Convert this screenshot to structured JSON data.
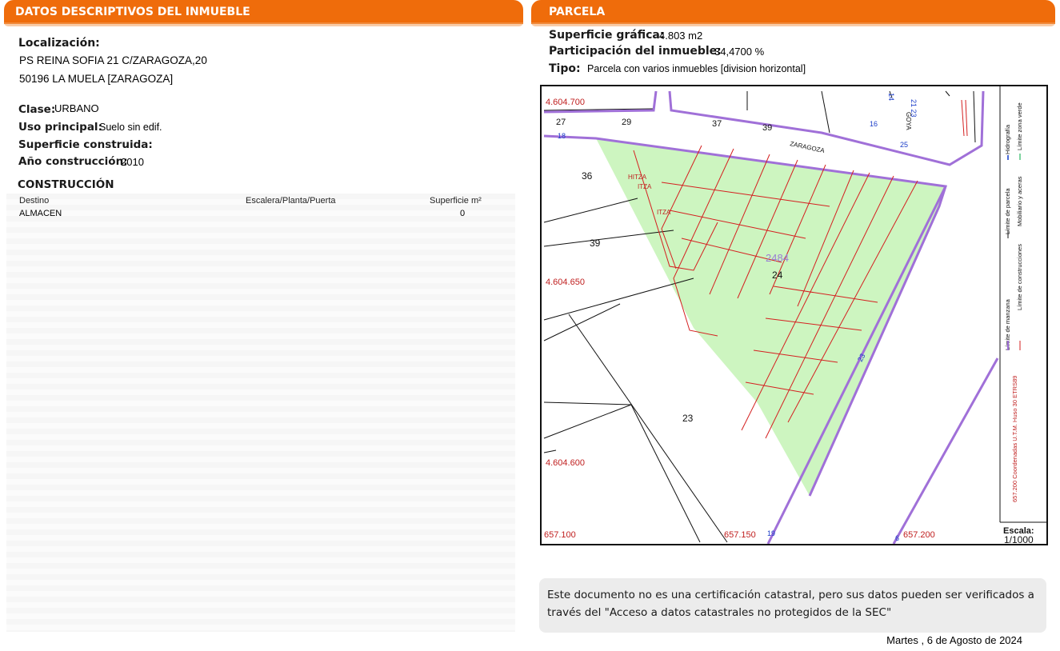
{
  "left": {
    "header": "DATOS DESCRIPTIVOS DEL INMUEBLE",
    "localizacion_label": "Localización:",
    "address_line1": "PS REINA SOFIA 21 C/ZARAGOZA,20",
    "address_line2": "50196 LA MUELA [ZARAGOZA]",
    "clase_label": "Clase:",
    "clase_value": "URBANO",
    "uso_label": "Uso principal:",
    "uso_value": "Suelo sin edif.",
    "sup_construida_label": "Superficie construida:",
    "anio_label": "Año construcción:",
    "anio_value": "2010",
    "construccion_title": "CONSTRUCCIÓN",
    "table": {
      "headers": [
        "Destino",
        "Escalera/Planta/Puerta",
        "Superficie m²"
      ],
      "rows": [
        [
          "ALMACEN",
          "",
          "0"
        ]
      ]
    }
  },
  "right": {
    "header": "PARCELA",
    "sup_grafica_label": "Superficie gráfica:",
    "sup_grafica_value": "4.803 m2",
    "participacion_label": "Participación del inmueble:",
    "participacion_value": "34,4700 %",
    "tipo_label": "Tipo:",
    "tipo_value": "Parcela con varios inmuebles [division horizontal]"
  },
  "map": {
    "coords": {
      "y1": "4.604.700",
      "y2": "4.604.650",
      "y3": "4.604.600",
      "x1": "657.100",
      "x2": "657.150",
      "x3": "657.200"
    },
    "parcel_numbers": {
      "p27": "27",
      "p29": "29",
      "p37": "37",
      "p39top": "39",
      "p36": "36",
      "p39": "39",
      "p24": "24",
      "p23": "23",
      "p2484": "2484"
    },
    "street_numbers": {
      "n18": "18",
      "n16": "16",
      "n25": "25",
      "n23": "23",
      "n19": "19",
      "n6": "6",
      "n21": "21 23",
      "n14": "14"
    },
    "streets": {
      "zaragoza": "ZARAGOZA",
      "goya": "GOYA"
    },
    "labels": {
      "itza1": "HITZA",
      "itza2": "ITZA",
      "itza3": "ITZA"
    },
    "legend": {
      "manzana": "Límite de manzana",
      "parcela": "Límite de parcela",
      "hidrografia": "Hidrografía",
      "construcciones": "Límite de construcciones",
      "mobiliario": "Mobiliario y aceras",
      "zona_verde": "Límite zona verde",
      "coordenadas": "657.200 Coordenadas U.T.M. Huso 30 ETRS89"
    },
    "scale_label": "Escala:",
    "scale_value": "1/1000",
    "colors": {
      "manzana": "#a070d8",
      "construcciones": "#d42020",
      "zona_verde": "#cdf5c0",
      "parcela": "#111111"
    }
  },
  "note": "Este documento no es una certificación catastral, pero sus datos pueden ser verificados a través del \"Acceso a datos catastrales no protegidos de la SEC\"",
  "date": "Martes , 6 de Agosto de 2024"
}
